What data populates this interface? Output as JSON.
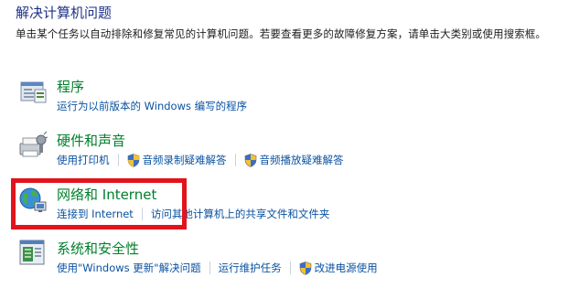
{
  "header": {
    "title": "解决计算机问题",
    "description": "单击某个任务以自动排除和修复常见的计算机问题。若要查看更多的故障修复方案，请单击大类别或使用搜索框。"
  },
  "categories": [
    {
      "title": "程序",
      "icon": "programs-icon",
      "links": [
        {
          "label": "运行为以前版本的 Windows 编写的程序"
        }
      ]
    },
    {
      "title": "硬件和声音",
      "icon": "hardware-sound-icon",
      "links": [
        {
          "label": "使用打印机"
        },
        {
          "label": "音频录制疑难解答",
          "icon": "shield-icon"
        },
        {
          "label": "音频播放疑难解答",
          "icon": "shield-icon"
        }
      ]
    },
    {
      "title": "网络和 Internet",
      "icon": "network-internet-icon",
      "links": [
        {
          "label": "连接到 Internet"
        },
        {
          "label": "访问其他计算机上的共享文件和文件夹"
        }
      ]
    },
    {
      "title": "系统和安全性",
      "icon": "system-security-icon",
      "links": [
        {
          "label": "使用\"Windows 更新\"解决问题"
        },
        {
          "label": "运行维护任务"
        },
        {
          "label": "改进电源使用",
          "icon": "shield-icon"
        }
      ]
    }
  ],
  "colors": {
    "category_title": "#00802b",
    "link": "#0a52a0",
    "page_title": "#1e3287",
    "highlight_box": "#e2141b"
  }
}
